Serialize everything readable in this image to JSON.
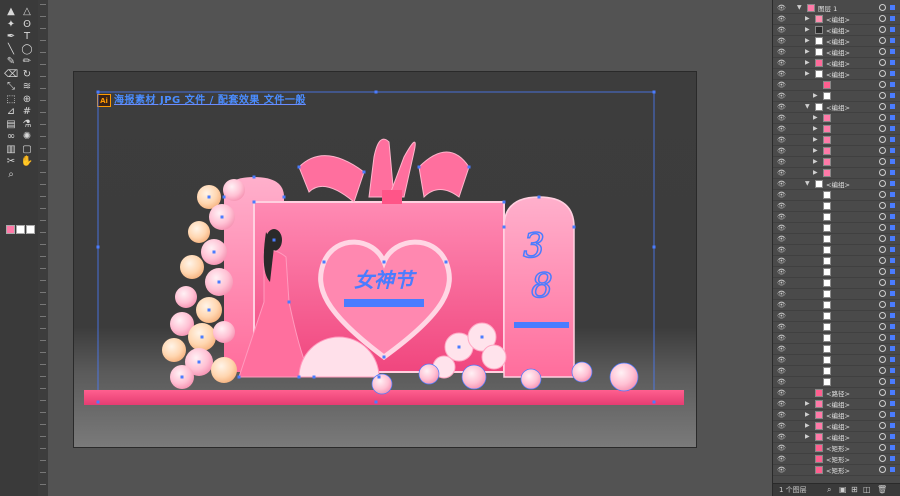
{
  "artboard": {
    "badge": "Ai",
    "title": "海报素材 JPG 文件 / 配套效果 文件一般"
  },
  "artwork": {
    "heart_title": "女神节",
    "heart_subtitle": "",
    "arch_number_top": "3",
    "arch_number_bottom": "8"
  },
  "layers": {
    "top_layer_name": "图层 1",
    "count_label": "1 个图层",
    "rows": [
      {
        "name": "图层 1",
        "thumb": "#ff7aa8",
        "indent": 0,
        "arrow": "▼"
      },
      {
        "name": "<编组>",
        "thumb": "#ff8fb0",
        "indent": 1,
        "arrow": "▶"
      },
      {
        "name": "<编组>",
        "thumb": "#2b2b2b",
        "indent": 1,
        "arrow": "▶"
      },
      {
        "name": "<编组>",
        "thumb": "#ffffff",
        "indent": 1,
        "arrow": "▶"
      },
      {
        "name": "<编组>",
        "thumb": "#ffffff",
        "indent": 1,
        "arrow": "▶"
      },
      {
        "name": "<编组>",
        "thumb": "#ff6b9a",
        "indent": 1,
        "arrow": "▶"
      },
      {
        "name": "<编组>",
        "thumb": "#ffffff",
        "indent": 1,
        "arrow": "▶"
      },
      {
        "name": "",
        "thumb": "#ff5f8f",
        "indent": 2,
        "arrow": ""
      },
      {
        "name": "",
        "thumb": "#ffffff",
        "indent": 2,
        "arrow": "▶"
      },
      {
        "name": "<编组>",
        "thumb": "#ffffff",
        "indent": 1,
        "arrow": "▼"
      },
      {
        "name": "",
        "thumb": "#ff7aa8",
        "indent": 2,
        "arrow": "▶"
      },
      {
        "name": "",
        "thumb": "#ff7aa8",
        "indent": 2,
        "arrow": "▶"
      },
      {
        "name": "",
        "thumb": "#ff7aa8",
        "indent": 2,
        "arrow": "▶"
      },
      {
        "name": "",
        "thumb": "#ff7aa8",
        "indent": 2,
        "arrow": "▶"
      },
      {
        "name": "",
        "thumb": "#ff7aa8",
        "indent": 2,
        "arrow": "▶"
      },
      {
        "name": "",
        "thumb": "#ff7aa8",
        "indent": 2,
        "arrow": "▶"
      },
      {
        "name": "<编组>",
        "thumb": "#ffffff",
        "indent": 1,
        "arrow": "▼"
      },
      {
        "name": "",
        "thumb": "#ffffff",
        "indent": 2,
        "arrow": ""
      },
      {
        "name": "",
        "thumb": "#ffffff",
        "indent": 2,
        "arrow": ""
      },
      {
        "name": "",
        "thumb": "#ffffff",
        "indent": 2,
        "arrow": ""
      },
      {
        "name": "",
        "thumb": "#ffffff",
        "indent": 2,
        "arrow": ""
      },
      {
        "name": "",
        "thumb": "#ffffff",
        "indent": 2,
        "arrow": ""
      },
      {
        "name": "",
        "thumb": "#ffffff",
        "indent": 2,
        "arrow": ""
      },
      {
        "name": "",
        "thumb": "#ffffff",
        "indent": 2,
        "arrow": ""
      },
      {
        "name": "",
        "thumb": "#ffffff",
        "indent": 2,
        "arrow": ""
      },
      {
        "name": "",
        "thumb": "#ffffff",
        "indent": 2,
        "arrow": ""
      },
      {
        "name": "",
        "thumb": "#ffffff",
        "indent": 2,
        "arrow": ""
      },
      {
        "name": "",
        "thumb": "#ffffff",
        "indent": 2,
        "arrow": ""
      },
      {
        "name": "",
        "thumb": "#ffffff",
        "indent": 2,
        "arrow": ""
      },
      {
        "name": "",
        "thumb": "#ffffff",
        "indent": 2,
        "arrow": ""
      },
      {
        "name": "",
        "thumb": "#ffffff",
        "indent": 2,
        "arrow": ""
      },
      {
        "name": "",
        "thumb": "#ffffff",
        "indent": 2,
        "arrow": ""
      },
      {
        "name": "",
        "thumb": "#ffffff",
        "indent": 2,
        "arrow": ""
      },
      {
        "name": "",
        "thumb": "#ffffff",
        "indent": 2,
        "arrow": ""
      },
      {
        "name": "",
        "thumb": "#ffffff",
        "indent": 2,
        "arrow": ""
      },
      {
        "name": "<路径>",
        "thumb": "#ff5f8f",
        "indent": 1,
        "arrow": ""
      },
      {
        "name": "<编组>",
        "thumb": "#ff7aa8",
        "indent": 1,
        "arrow": "▶"
      },
      {
        "name": "<编组>",
        "thumb": "#ff7aa8",
        "indent": 1,
        "arrow": "▶"
      },
      {
        "name": "<编组>",
        "thumb": "#ff7aa8",
        "indent": 1,
        "arrow": "▶"
      },
      {
        "name": "<编组>",
        "thumb": "#ff7aa8",
        "indent": 1,
        "arrow": "▶"
      },
      {
        "name": "<矩形>",
        "thumb": "#ff5f8f",
        "indent": 1,
        "arrow": ""
      },
      {
        "name": "<矩形>",
        "thumb": "#ff5f8f",
        "indent": 1,
        "arrow": ""
      },
      {
        "name": "<矩形>",
        "thumb": "#ff5f8f",
        "indent": 1,
        "arrow": ""
      }
    ]
  },
  "colors": {
    "selection": "#4a7cff",
    "pink": "#ff6f9e",
    "pink_dark": "#ee4e82",
    "peach": "#ffc9a0"
  },
  "tools": [
    "selection-tool",
    "direct-selection-tool",
    "magic-wand-tool",
    "lasso-tool",
    "pen-tool",
    "type-tool",
    "line-tool",
    "ellipse-tool",
    "paintbrush-tool",
    "pencil-tool",
    "eraser-tool",
    "rotate-tool",
    "scale-tool",
    "warp-tool",
    "free-transform-tool",
    "shape-builder-tool",
    "perspective-tool",
    "mesh-tool",
    "gradient-tool",
    "eyedropper-tool",
    "blend-tool",
    "symbol-sprayer-tool",
    "column-graph-tool",
    "artboard-tool",
    "slice-tool",
    "hand-tool",
    "zoom-tool"
  ]
}
